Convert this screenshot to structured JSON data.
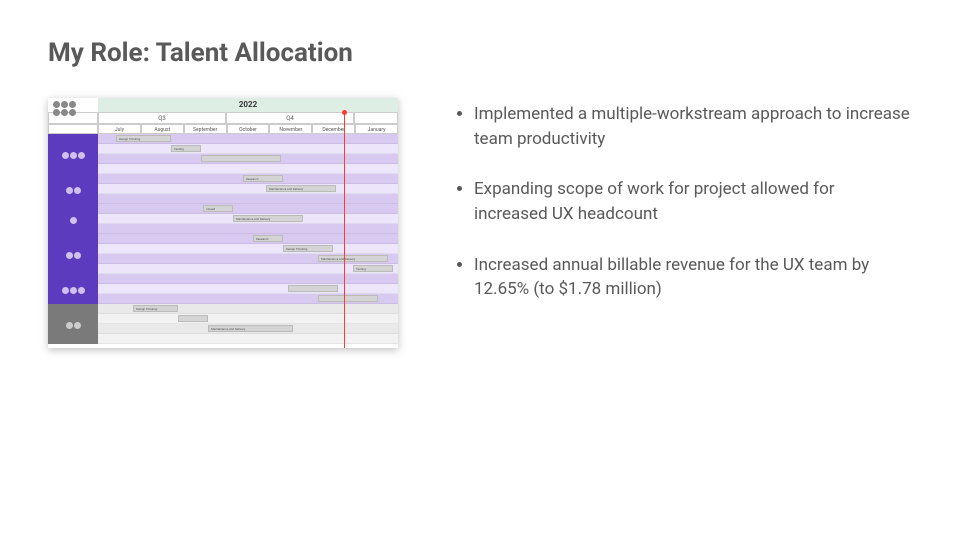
{
  "title": "My Role: Talent Allocation",
  "bullets": [
    "Implemented a multiple-workstream approach to increase team productivity",
    "Expanding scope of work for project allowed for increased UX headcount",
    "Increased annual billable revenue for the UX team by 12.65% (to $1.78 million)"
  ],
  "gantt": {
    "year": "2022",
    "quarters": [
      "Q3",
      "Q4"
    ],
    "months": [
      "July",
      "August",
      "September",
      "October",
      "November",
      "December",
      "January"
    ],
    "bar_labels": {
      "design_thinking": "Design Thinking",
      "testing": "Testing",
      "research": "Research",
      "maintenance_delivery": "Maintenance and Delivery",
      "closed": "Closed"
    }
  }
}
